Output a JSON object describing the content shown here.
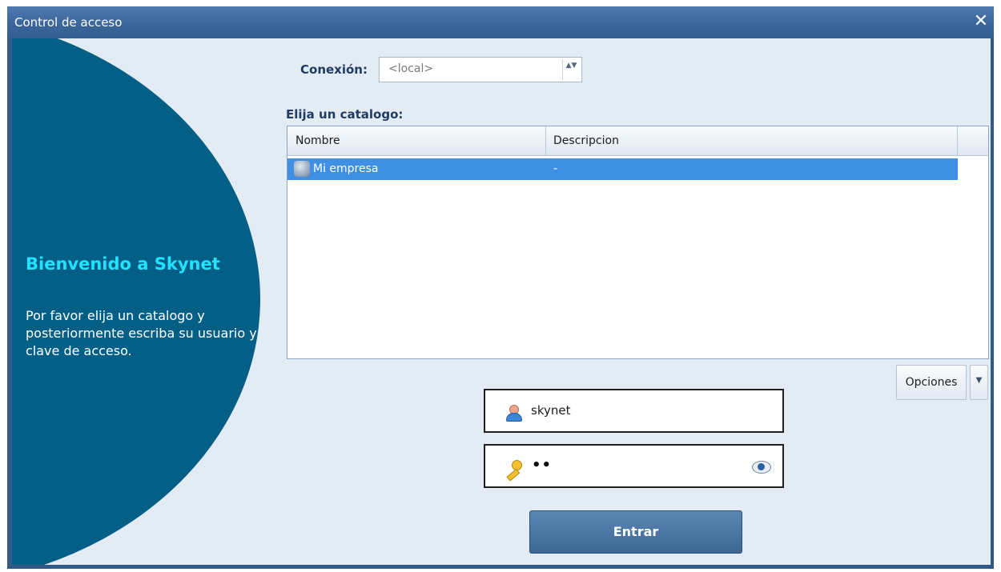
{
  "window": {
    "title": "Control de acceso",
    "close_glyph": "✕"
  },
  "welcome": {
    "title": "Bienvenido a Skynet",
    "text": "Por favor elija un catalogo y posteriormente escriba su usuario y clave de acceso."
  },
  "connection": {
    "label": "Conexión:",
    "value": "<local>",
    "spinner_glyph": "▲▼"
  },
  "catalog": {
    "label": "Elija un catalogo:",
    "columns": [
      "Nombre",
      "Descripcion"
    ],
    "rows": [
      {
        "name": "Mi empresa",
        "description": "-",
        "icon": "database-icon",
        "selected": true
      }
    ]
  },
  "options": {
    "label": "Opciones",
    "dropdown_glyph": "▼"
  },
  "login": {
    "username": "skynet",
    "password_mask": "••",
    "user_icon": "user-icon",
    "key_icon": "key-icon",
    "eye_icon": "show-password-icon"
  },
  "enter": {
    "label": "Entrar"
  },
  "colors": {
    "titlebar": "#3a6599",
    "panel_circle": "#045f87",
    "welcome_title": "#21e2ff",
    "selection": "#3f90e2",
    "client_bg": "#e3ebf4",
    "button": "#4a7aa6"
  }
}
